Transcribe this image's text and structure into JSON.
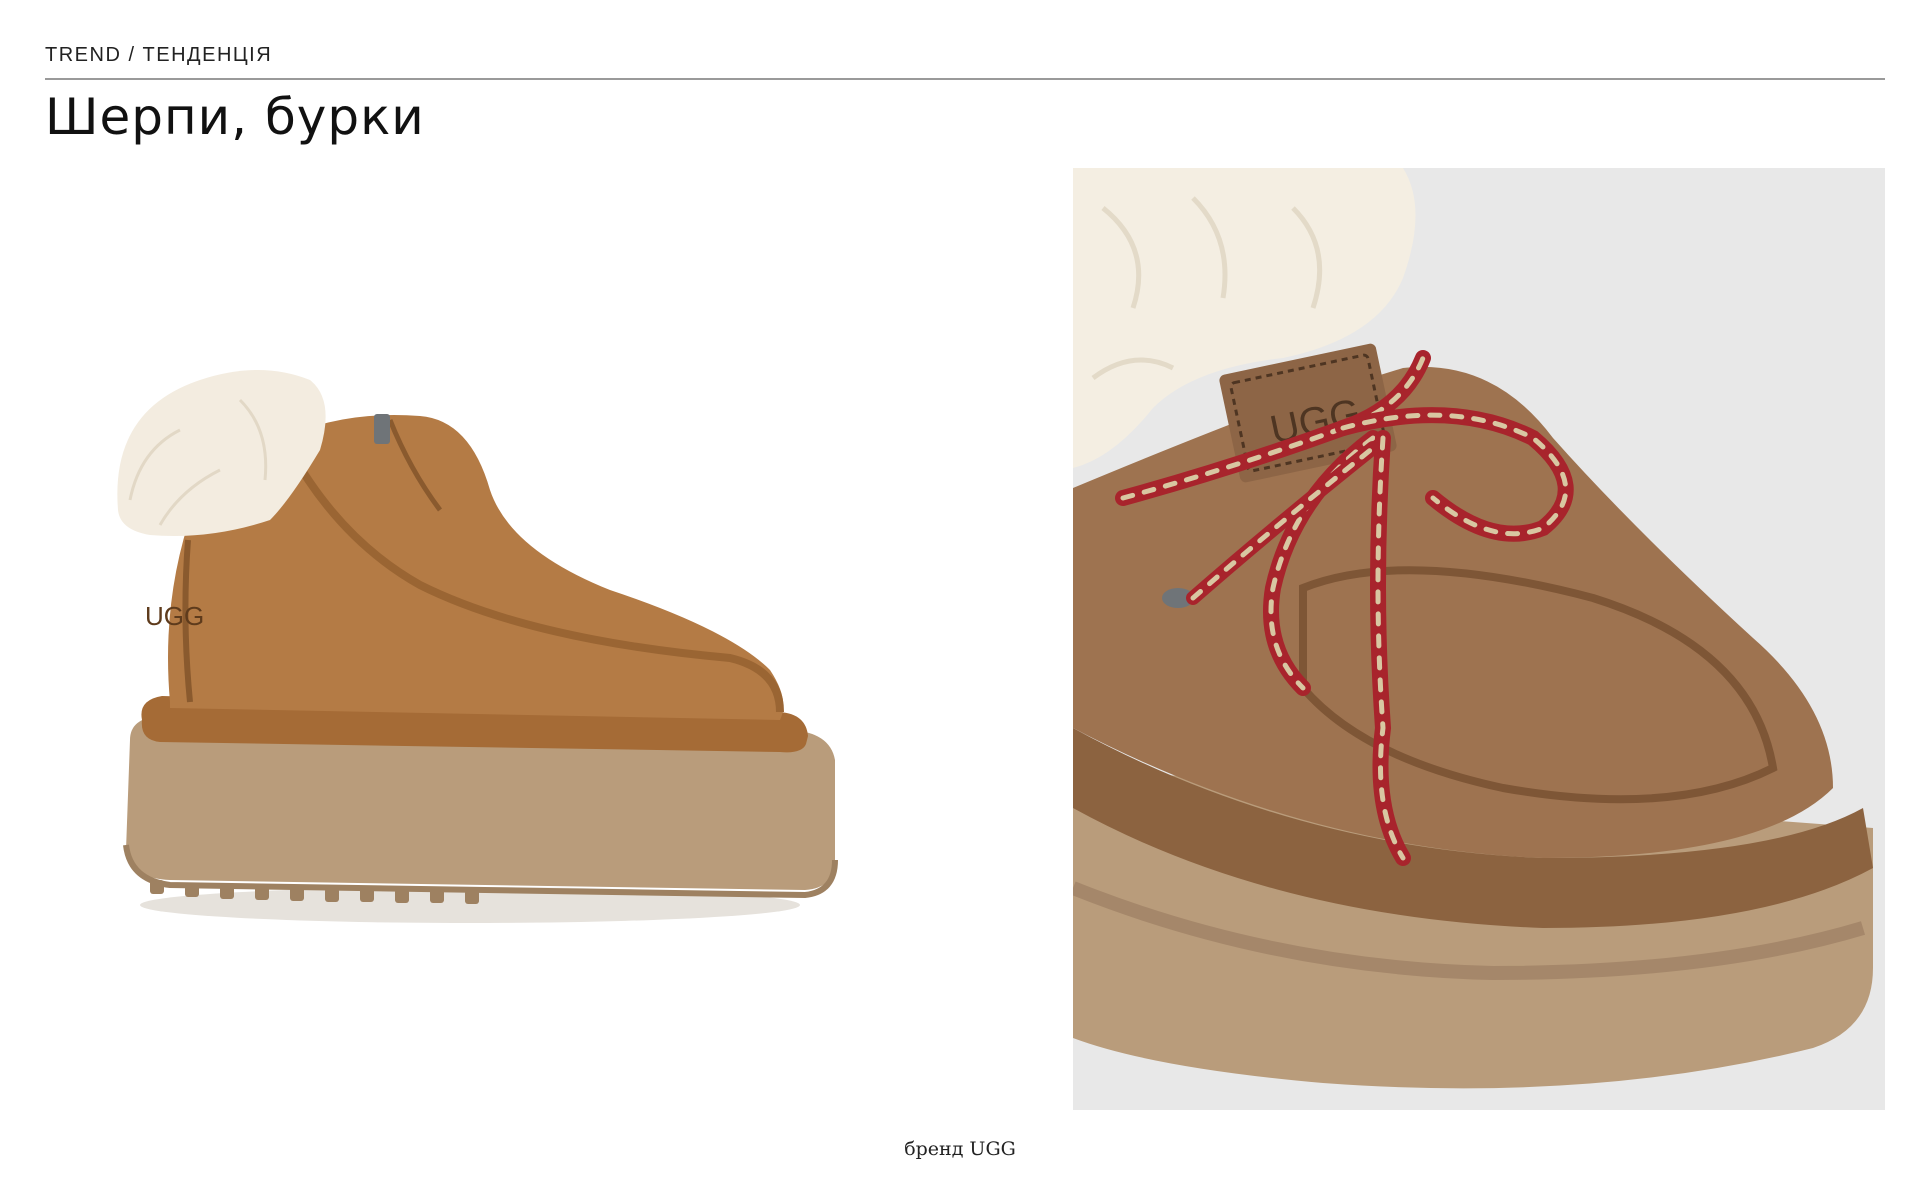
{
  "header": {
    "kicker": "TREND / ТЕНДЕНЦІЯ",
    "title": "Шерпи, бурки"
  },
  "images": {
    "left": {
      "subject": "chestnut suede zip platform boot with sheepskin collar",
      "logo_text": "UGG"
    },
    "right": {
      "subject": "close-up of suede platform moc with sherpa cuff and red braided laces",
      "logo_text": "UGG"
    }
  },
  "caption": "бренд UGG",
  "colors": {
    "suede": "#b07a45",
    "suede_dark": "#8a5a2e",
    "sole": "#b89a78",
    "sherpa": "#f3ece0",
    "lace_red": "#a8242c",
    "right_bg": "#e8e8e8",
    "rule": "#9a9a9a"
  }
}
